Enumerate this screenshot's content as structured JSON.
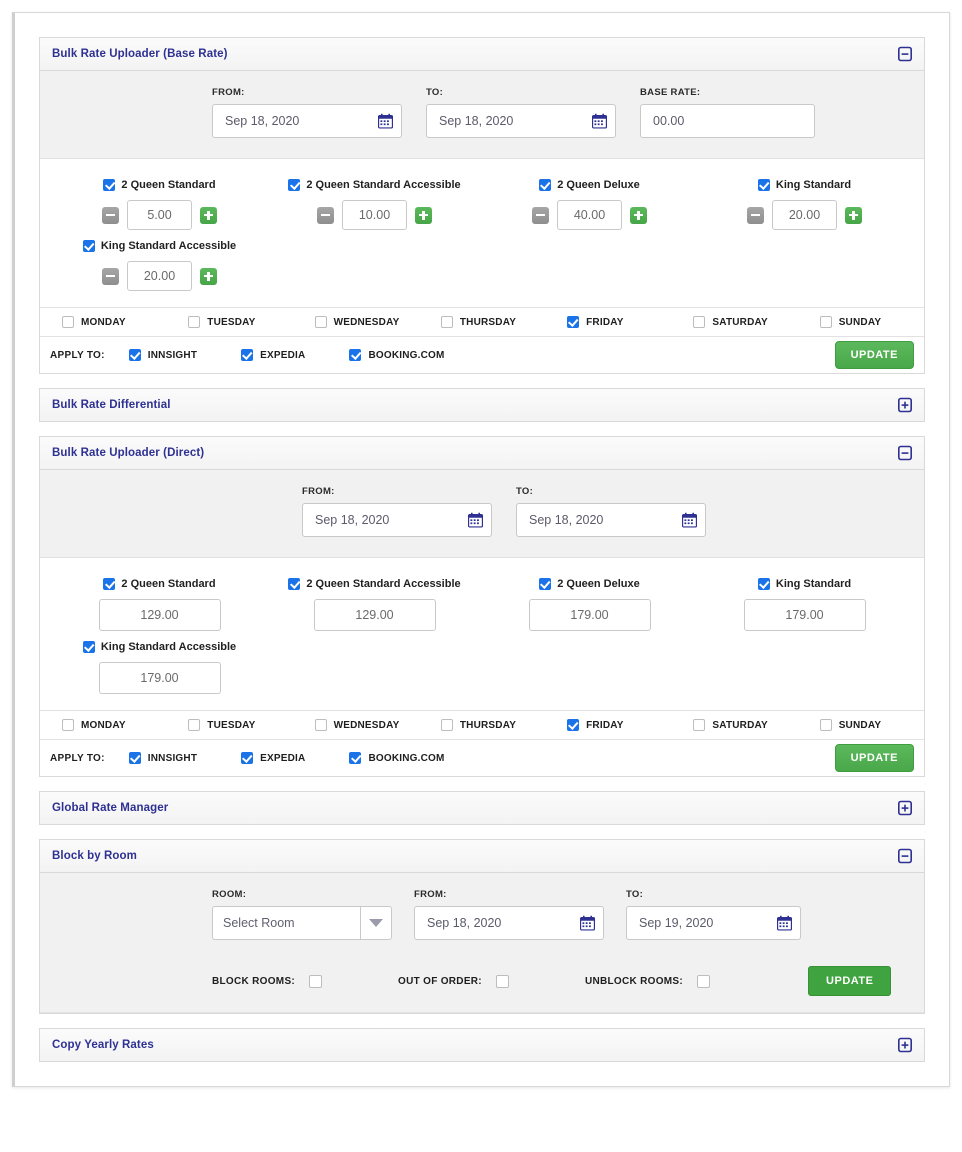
{
  "panels": {
    "base_rate": {
      "title": "Bulk Rate Uploader (Base Rate)",
      "toggle": "collapse-icon",
      "from_label": "FROM:",
      "from_value": "Sep 18, 2020",
      "to_label": "TO:",
      "to_value": "Sep 18, 2020",
      "base_rate_label": "BASE RATE:",
      "base_rate_value": "00.00",
      "rooms": [
        {
          "name": "2 Queen Standard",
          "checked": true,
          "value": "5.00"
        },
        {
          "name": "2 Queen Standard Accessible",
          "checked": true,
          "value": "10.00"
        },
        {
          "name": "2 Queen Deluxe",
          "checked": true,
          "value": "40.00"
        },
        {
          "name": "King Standard",
          "checked": true,
          "value": "20.00"
        },
        {
          "name": "King Standard Accessible",
          "checked": true,
          "value": "20.00"
        }
      ]
    },
    "differential": {
      "title": "Bulk Rate Differential",
      "toggle": "expand-icon"
    },
    "direct": {
      "title": "Bulk Rate Uploader (Direct)",
      "toggle": "collapse-icon",
      "from_label": "FROM:",
      "from_value": "Sep 18, 2020",
      "to_label": "TO:",
      "to_value": "Sep 18, 2020",
      "rooms": [
        {
          "name": "2 Queen Standard",
          "checked": true,
          "value": "129.00"
        },
        {
          "name": "2 Queen Standard Accessible",
          "checked": true,
          "value": "129.00"
        },
        {
          "name": "2 Queen Deluxe",
          "checked": true,
          "value": "179.00"
        },
        {
          "name": "King Standard",
          "checked": true,
          "value": "179.00"
        },
        {
          "name": "King Standard Accessible",
          "checked": true,
          "value": "179.00"
        }
      ]
    },
    "global_rate_manager": {
      "title": "Global Rate Manager",
      "toggle": "expand-icon"
    },
    "block_by_room": {
      "title": "Block by Room",
      "toggle": "collapse-icon",
      "room_label": "ROOM:",
      "room_value": "Select Room",
      "from_label": "FROM:",
      "from_value": "Sep 18, 2020",
      "to_label": "TO:",
      "to_value": "Sep 19, 2020",
      "options": [
        {
          "label": "BLOCK ROOMS:",
          "checked": false
        },
        {
          "label": "OUT OF ORDER:",
          "checked": false
        },
        {
          "label": "UNBLOCK ROOMS:",
          "checked": false
        }
      ],
      "update_label": "UPDATE"
    },
    "copy_yearly": {
      "title": "Copy Yearly Rates",
      "toggle": "expand-icon"
    }
  },
  "days": [
    {
      "label": "MONDAY",
      "checked": false
    },
    {
      "label": "TUESDAY",
      "checked": false
    },
    {
      "label": "WEDNESDAY",
      "checked": false
    },
    {
      "label": "THURSDAY",
      "checked": false
    },
    {
      "label": "FRIDAY",
      "checked": true
    },
    {
      "label": "SATURDAY",
      "checked": false
    },
    {
      "label": "SUNDAY",
      "checked": false
    }
  ],
  "apply_to": {
    "label": "APPLY TO:",
    "channels": [
      {
        "label": "INNSIGHT",
        "checked": true
      },
      {
        "label": "EXPEDIA",
        "checked": true
      },
      {
        "label": "BOOKING.COM",
        "checked": true
      }
    ],
    "update_label": "UPDATE"
  },
  "colors": {
    "title_blue": "#2e3192",
    "checkbox_blue": "#1a73e8",
    "update_green": "#4aab4a",
    "minus_grey": "#9a9a9a",
    "plus_green": "#4fae4f"
  }
}
